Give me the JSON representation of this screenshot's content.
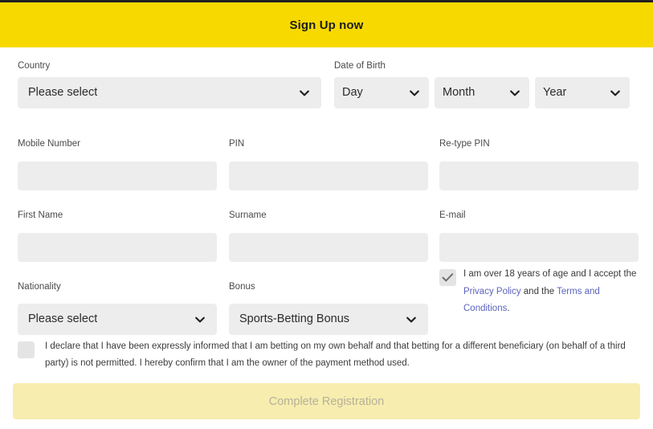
{
  "header": {
    "title": "Sign Up now",
    "background_color": "#F7D900",
    "text_color": "#1D1D1B"
  },
  "theme": {
    "accent_yellow": "#F7D900",
    "field_gray": "#EDEDED",
    "link_color": "#5B63BD",
    "disabled_button_bg": "#F7EDAE",
    "disabled_button_text": "#B7B09A",
    "label_color": "#4A4A4A"
  },
  "form": {
    "country": {
      "label": "Country",
      "value": "Please select",
      "chevron_icon": "chevron-down-icon"
    },
    "date_of_birth": {
      "label": "Date of Birth",
      "day": {
        "value": "Day",
        "chevron_icon": "chevron-down-icon"
      },
      "month": {
        "value": "Month",
        "chevron_icon": "chevron-down-icon"
      },
      "year": {
        "value": "Year",
        "chevron_icon": "chevron-down-icon"
      }
    },
    "mobile_number": {
      "label": "Mobile Number",
      "value": "",
      "placeholder": ""
    },
    "pin": {
      "label": "PIN",
      "value": "",
      "placeholder": ""
    },
    "retype_pin": {
      "label": "Re-type PIN",
      "value": "",
      "placeholder": ""
    },
    "first_name": {
      "label": "First Name",
      "value": "",
      "placeholder": ""
    },
    "surname": {
      "label": "Surname",
      "value": "",
      "placeholder": ""
    },
    "email": {
      "label": "E-mail",
      "value": "",
      "placeholder": ""
    },
    "nationality": {
      "label": "Nationality",
      "value": "Please select",
      "chevron_icon": "chevron-down-icon"
    },
    "bonus": {
      "label": "Bonus",
      "value": "Sports-Betting Bonus",
      "chevron_icon": "chevron-down-icon"
    }
  },
  "consents": {
    "age_consent": {
      "checked": true,
      "check_icon": "checkmark-icon",
      "text_part_1": "I am over 18 years of age and I accept the ",
      "privacy_policy_link": "Privacy Policy",
      "text_part_2": " and the ",
      "terms_link": "Terms and Conditions",
      "text_part_3": "."
    },
    "declaration": {
      "checked": false,
      "text": "I declare that I have been expressly informed that I am betting on my own behalf and that betting for a different beneficiary (on behalf of a third party) is not permitted. I hereby confirm that I am the owner of the payment method used."
    }
  },
  "submit": {
    "label": "Complete Registration",
    "disabled": true
  }
}
